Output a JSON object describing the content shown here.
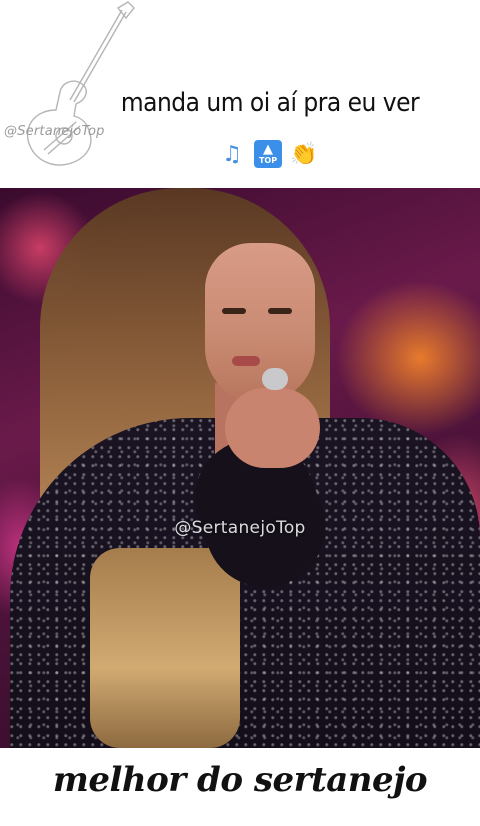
{
  "header": {
    "logo_text": "@SertanejoTop",
    "caption": "manda um oi aí pra eu ver",
    "emojis": [
      {
        "icon": "musical-notes-icon",
        "glyph": "🎶"
      },
      {
        "icon": "top-arrow-icon",
        "glyph": "TOP"
      },
      {
        "icon": "clapping-hands-icon",
        "glyph": "👏"
      }
    ]
  },
  "video": {
    "watermark": "@SertanejoTop"
  },
  "footer": {
    "text": "melhor do sertanejo"
  },
  "colors": {
    "background": "#ffffff",
    "caption_text": "#111111",
    "watermark_text": "#ffffff",
    "top_badge": "#3b8fe8"
  }
}
